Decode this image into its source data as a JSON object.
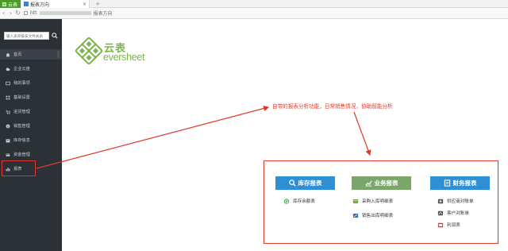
{
  "browser": {
    "tabs": [
      {
        "label": "云表",
        "color": "#4c9a2a"
      },
      {
        "label": "报表方向"
      }
    ],
    "new_tab_symbol": "+",
    "address_prefix": "htt",
    "address_suffix": "报表方向"
  },
  "sidebar": {
    "search_placeholder": "输入表单报表文件关表",
    "items": [
      {
        "label": "首页",
        "icon": "home-icon"
      },
      {
        "label": "企业云盘",
        "icon": "cloud-icon"
      },
      {
        "label": "我的事项",
        "icon": "inbox-icon"
      },
      {
        "label": "基础设置",
        "icon": "grid-icon"
      },
      {
        "label": "进货管理",
        "icon": "cart-icon"
      },
      {
        "label": "销售管理",
        "icon": "sales-icon"
      },
      {
        "label": "库存信息",
        "icon": "stock-icon"
      },
      {
        "label": "资金管理",
        "icon": "money-icon"
      },
      {
        "label": "报表",
        "icon": "chart-icon"
      }
    ],
    "colors": {
      "bg": "#2c3138",
      "text": "#c8cdd2"
    }
  },
  "logo": {
    "top_text": "云表",
    "bottom_text": "eversheet",
    "color": "#7ab648"
  },
  "annotation": {
    "text": "自带的报表分析功能，日常销售情况，协助智能分析",
    "color": "#e0392b"
  },
  "report_panel": {
    "categories": [
      {
        "label": "库存报表",
        "icon": "search-icon",
        "color": "#2f8fd5",
        "items": [
          {
            "label": "库存余额表",
            "icon": "q-icon"
          }
        ]
      },
      {
        "label": "业务报表",
        "icon": "trend-icon",
        "color": "#7aa66a",
        "items": [
          {
            "label": "采购入库明细表",
            "icon": "purchase-icon"
          },
          {
            "label": "销售出库明细表",
            "icon": "sales-out-icon"
          }
        ]
      },
      {
        "label": "财务报表",
        "icon": "report-icon",
        "color": "#2f8fd5",
        "items": [
          {
            "label": "供应商对账单",
            "icon": "supplier-icon"
          },
          {
            "label": "客户对账单",
            "icon": "customer-icon"
          },
          {
            "label": "利润表",
            "icon": "profit-icon"
          }
        ]
      }
    ]
  }
}
